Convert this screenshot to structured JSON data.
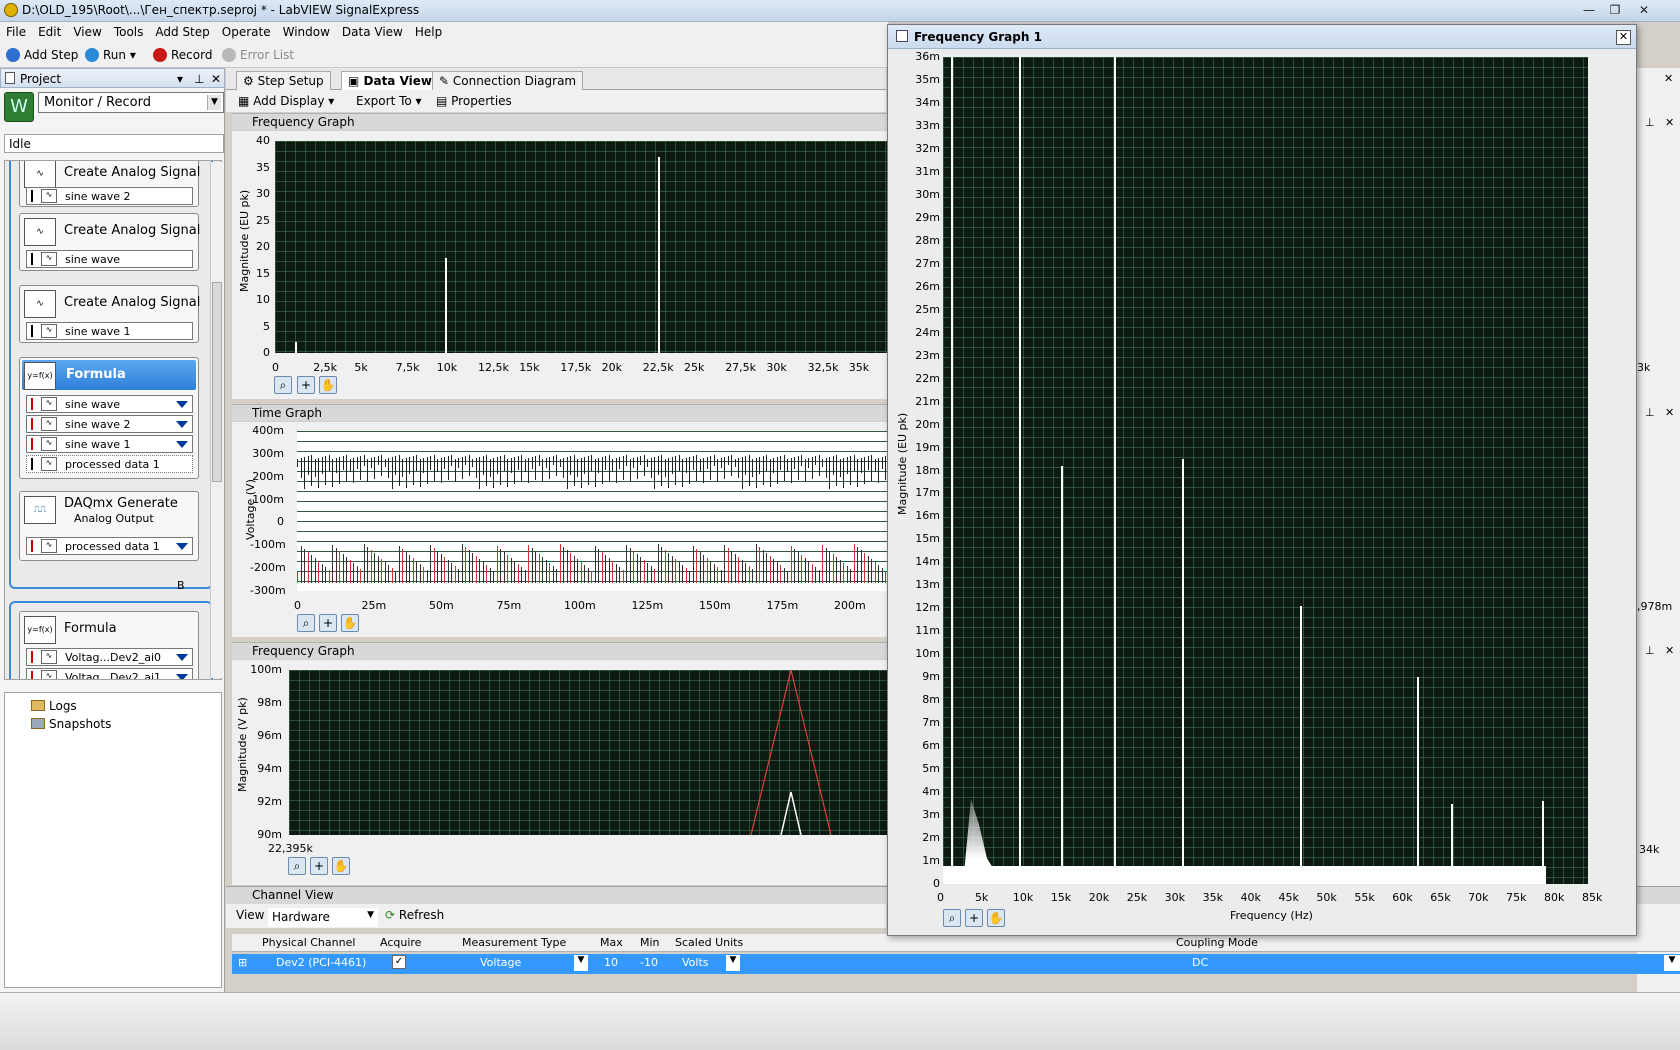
{
  "window": {
    "title": "D:\\OLD_195\\Root\\...\\Ген_спектр.seproj * - LabVIEW SignalExpress",
    "controls": [
      "—",
      "❐",
      "✕"
    ]
  },
  "menu": [
    "File",
    "Edit",
    "View",
    "Tools",
    "Add Step",
    "Operate",
    "Window",
    "Data View",
    "Help"
  ],
  "toolbar": {
    "add_step": "Add Step",
    "run": "Run",
    "record": "Record",
    "error_list": "Error List"
  },
  "project": {
    "header": "Project",
    "mode": "Monitor / Record",
    "status": "Idle",
    "steps": [
      {
        "name": "Create Analog Signal",
        "channels": [
          "sine wave 2"
        ]
      },
      {
        "name": "Create Analog Signal",
        "channels": [
          "sine wave"
        ]
      },
      {
        "name": "Create Analog Signal",
        "channels": [
          "sine wave 1"
        ]
      },
      {
        "name": "Formula",
        "channels": [
          "sine wave",
          "sine wave 2",
          "sine wave 1",
          "processed data 1"
        ]
      },
      {
        "name": "DAQmx Generate",
        "subtitle": "Analog Output",
        "channels": [
          "processed data 1"
        ]
      },
      {
        "name": "Formula",
        "channels": [
          "Voltag...Dev2_ai0",
          "Voltag...Dev2_ai1"
        ]
      }
    ],
    "loop_label": "B",
    "tree": [
      "Logs",
      "Snapshots"
    ]
  },
  "tabs": [
    "Step Setup",
    "Data View",
    "Connection Diagram"
  ],
  "dataview_toolbar": {
    "add_display": "Add Display",
    "export_to": "Export To",
    "properties": "Properties"
  },
  "graphs": {
    "freq1": {
      "title": "Frequency Graph",
      "ylabel": "Magnitude (EU pk)",
      "yticks": [
        "40",
        "35",
        "30",
        "25",
        "20",
        "15",
        "10",
        "5",
        "0"
      ],
      "xticks": [
        "0",
        "2,5k",
        "5k",
        "7,5k",
        "10k",
        "12,5k",
        "15k",
        "17,5k",
        "20k",
        "22,5k",
        "25k",
        "27,5k",
        "30k",
        "32,5k",
        "35k",
        "3"
      ]
    },
    "time": {
      "title": "Time Graph",
      "ylabel": "Voltage (V)",
      "yticks": [
        "400m",
        "300m",
        "200m",
        "100m",
        "0",
        "-100m",
        "-200m",
        "-300m"
      ],
      "xticks": [
        "0",
        "25m",
        "50m",
        "75m",
        "100m",
        "125m",
        "150m",
        "175m",
        "200m"
      ]
    },
    "freq2": {
      "title": "Frequency Graph",
      "ylabel": "Magnitude (V pk)",
      "yticks": [
        "100m",
        "98m",
        "96m",
        "94m",
        "92m",
        "90m"
      ],
      "xstart": "22,395k"
    }
  },
  "right_edge_labels": {
    "k1": "3k",
    "k2": ",978m",
    "k3": "34k"
  },
  "channel_view": {
    "title": "Channel View",
    "view_label": "View",
    "view_value": "Hardware",
    "refresh": "Refresh",
    "columns": [
      "Physical Channel",
      "Acquire",
      "Measurement Type",
      "Max",
      "Min",
      "Scaled Units",
      "Coupling Mode"
    ],
    "row": {
      "channel": "Dev2 (PCI-4461)",
      "acquire": "✓",
      "type": "Voltage",
      "max": "10",
      "min": "-10",
      "units": "Volts",
      "coupling": "DC"
    }
  },
  "popup": {
    "title": "Frequency Graph 1",
    "ylabel": "Magnitude (EU pk)",
    "xlabel": "Frequency (Hz)",
    "yticks": [
      "36m",
      "35m",
      "34m",
      "33m",
      "32m",
      "31m",
      "30m",
      "29m",
      "28m",
      "27m",
      "26m",
      "25m",
      "24m",
      "23m",
      "22m",
      "21m",
      "20m",
      "19m",
      "18m",
      "17m",
      "16m",
      "15m",
      "14m",
      "13m",
      "12m",
      "11m",
      "10m",
      "9m",
      "8m",
      "7m",
      "6m",
      "5m",
      "4m",
      "3m",
      "2m",
      "1m",
      "0"
    ],
    "xticks": [
      "0",
      "5k",
      "10k",
      "15k",
      "20k",
      "25k",
      "30k",
      "35k",
      "40k",
      "45k",
      "50k",
      "55k",
      "60k",
      "65k",
      "70k",
      "75k",
      "80k",
      "85k"
    ]
  },
  "chart_data": [
    {
      "type": "line",
      "title": "Frequency Graph 1",
      "xlabel": "Frequency (Hz)",
      "ylabel": "Magnitude (EU pk)",
      "xlim": [
        0,
        85000
      ],
      "ylim": [
        0,
        0.036
      ],
      "grid": true,
      "peaks_x": [
        1000,
        10000,
        15500,
        22500,
        31500,
        47000,
        62500,
        67000,
        79000
      ],
      "peaks_y": [
        0.036,
        0.036,
        0.0182,
        0.036,
        0.0185,
        0.0121,
        0.009,
        0.0035,
        0.0036
      ],
      "noise_floor": 0.0008
    },
    {
      "type": "line",
      "title": "Frequency Graph",
      "ylabel": "Magnitude (EU pk)",
      "xlim": [
        0,
        36000
      ],
      "ylim": [
        0,
        40
      ],
      "peaks_x": [
        1200,
        10000,
        22500
      ],
      "peaks_y": [
        2,
        18,
        37
      ]
    },
    {
      "type": "line",
      "title": "Time Graph",
      "ylabel": "Voltage (V)",
      "xlim": [
        0,
        0.2
      ],
      "ylim": [
        -0.3,
        0.4
      ]
    }
  ]
}
